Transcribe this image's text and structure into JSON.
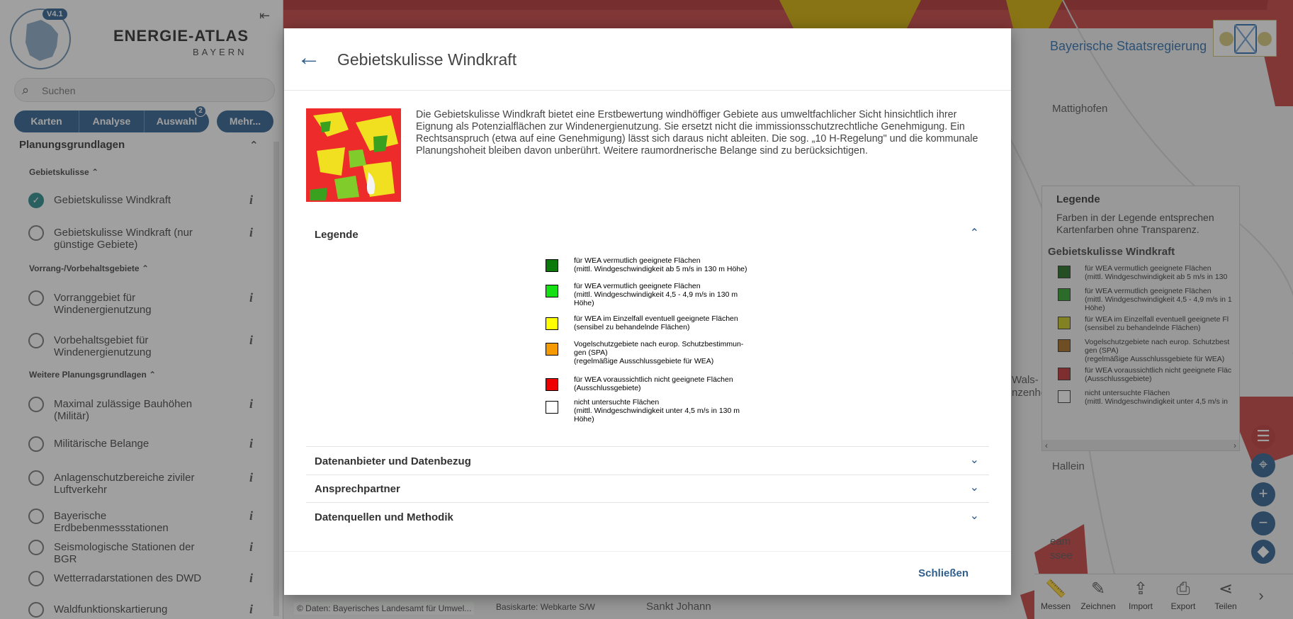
{
  "colors": {
    "brand": "#2f5f8e",
    "dark_green": "#0a7a0a",
    "light_green": "#14e014",
    "yellow": "#ffff00",
    "orange": "#f59a00",
    "red": "#ee0000",
    "white": "#ffffff"
  },
  "sidebar": {
    "version": "V4.1",
    "brand_title": "ENERGIE-ATLAS",
    "brand_sub": "BAYERN",
    "search_placeholder": "Suchen",
    "tabs": [
      {
        "label": "Karten"
      },
      {
        "label": "Analyse"
      },
      {
        "label": "Auswahl",
        "badge": "2"
      }
    ],
    "more_label": "Mehr...",
    "section_title": "Planungsgrundlagen",
    "groups": {
      "g1": "Gebietskulisse",
      "g2": "Vorrang-/Vorbehaltsgebiete",
      "g3": "Weitere Planungsgrundlagen"
    },
    "layers": [
      {
        "name": "Gebietskulisse Windkraft",
        "checked": true
      },
      {
        "name": "Gebietskulisse Windkraft (nur günstige Gebiete)"
      },
      {
        "name": "Vorranggebiet für Windenergienutzung"
      },
      {
        "name": "Vorbehaltsgebiet für Windenergienutzung"
      },
      {
        "name": "Maximal zulässige Bauhöhen (Militär)"
      },
      {
        "name": "Militärische Belange"
      },
      {
        "name": "Anlagenschutzbereiche ziviler Luftverkehr"
      },
      {
        "name": "Bayerische Erdbebenmessstationen"
      },
      {
        "name": "Seismologische Stationen der BGR"
      },
      {
        "name": "Wetterradarstationen des DWD"
      },
      {
        "name": "Waldfunktionskartierung"
      }
    ]
  },
  "header": {
    "gov_text": "Bayerische Staatsregierung"
  },
  "map": {
    "labels": [
      "Mattighofen",
      "Hallein",
      "Sankt Johann",
      "Wals-",
      "nzenhe",
      "eam",
      "ssee"
    ],
    "attribution": "© Daten: Bayerisches Landesamt für Umwel...",
    "basemap": "Basiskarte: Webkarte S/W"
  },
  "legend_panel": {
    "title": "Legende",
    "note": "Farben in der Legende entsprechen Kartenfarben ohne Transparenz.",
    "subtitle": "Gebietskulisse Windkraft",
    "items": [
      {
        "line1": "für WEA vermutlich geeignete Flächen",
        "line2": "(mittl. Windgeschwindigkeit ab 5 m/s in 130",
        "color": "#1f6b1f"
      },
      {
        "line1": "für WEA vermutlich geeignete Flächen",
        "line2": "(mittl. Windgeschwindigkeit 4,5 - 4,9 m/s in 1",
        "line3": "Höhe)",
        "color": "#2aa02a"
      },
      {
        "line1": "für WEA im Einzelfall eventuell geeignete Fl",
        "line2": "(sensibel zu behandelnde Flächen)",
        "color": "#c8c81e"
      },
      {
        "line1": "Vogelschutzgebiete nach europ. Schutzbest",
        "line2": "gen (SPA)",
        "line3": "(regelmäßige Ausschlussgebiete für WEA)",
        "color": "#a86a1e"
      },
      {
        "line1": "für WEA voraussichtlich nicht geeignete Fläc",
        "line2": "(Ausschlussgebiete)",
        "color": "#c23030"
      },
      {
        "line1": "nicht untersuchte Flächen",
        "line2": "(mittl. Windgeschwindigkeit unter 4,5 m/s in",
        "color": "#ffffff"
      }
    ]
  },
  "toolbar": [
    {
      "label": "Messen",
      "icon": "ruler-icon",
      "glyph": "📏"
    },
    {
      "label": "Zeichnen",
      "icon": "pencil-icon",
      "glyph": "✎"
    },
    {
      "label": "Import",
      "icon": "import-icon",
      "glyph": "⇪"
    },
    {
      "label": "Export",
      "icon": "printer-icon",
      "glyph": "⎙"
    },
    {
      "label": "Teilen",
      "icon": "share-icon",
      "glyph": "⋖"
    }
  ],
  "modal": {
    "title": "Gebietskulisse Windkraft",
    "description": "Die Gebietskulisse Windkraft bietet eine Erstbewertung windhöffiger Gebiete aus umweltfachlicher Sicht hinsichtlich ihrer Eignung als Potenzialflächen zur Windenergienutzung. Sie ersetzt nicht die immissionsschutzrechtliche Genehmigung. Ein Rechtsanspruch (etwa auf eine Genehmigung) lässt sich daraus nicht ableiten. Die sog. „10 H-Regelung\" und die kommunale Planungshoheit bleiben davon unberührt. Weitere raumordnerische Belange sind zu berücksichtigen.",
    "sections": [
      {
        "label": "Legende",
        "expanded": true
      },
      {
        "label": "Datenanbieter und Datenbezug",
        "expanded": false
      },
      {
        "label": "Ansprechpartner",
        "expanded": false
      },
      {
        "label": "Datenquellen und Methodik",
        "expanded": false
      }
    ],
    "legend": [
      {
        "line1": "für WEA vermutlich geeignete Flächen",
        "line2": "(mittl. Windgeschwindigkeit ab 5 m/s in 130 m Höhe)"
      },
      {
        "line1": "für WEA vermutlich geeignete Flächen",
        "line2": "(mittl. Windgeschwindigkeit 4,5 - 4,9 m/s in 130 m",
        "line3": "Höhe)"
      },
      {
        "line1": "für WEA im Einzelfall eventuell geeignete Flächen",
        "line2": "(sensibel zu behandelnde Flächen)"
      },
      {
        "line1": "Vogelschutzgebiete nach europ. Schutzbestimmun-",
        "line2": "gen (SPA)",
        "line3": "(regelmäßige Ausschlussgebiete für WEA)"
      },
      {
        "line1": "für WEA voraussichtlich nicht geeignete Flächen",
        "line2": "(Ausschlussgebiete)"
      },
      {
        "line1": "nicht untersuchte Flächen",
        "line2": "(mittl. Windgeschwindigkeit unter 4,5 m/s in 130 m",
        "line3": "Höhe)"
      }
    ],
    "close_label": "Schließen"
  }
}
